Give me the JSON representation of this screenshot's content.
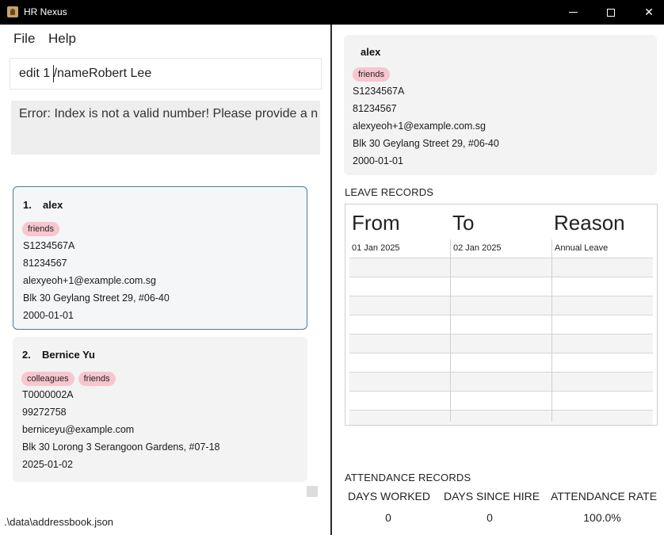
{
  "window": {
    "title": "HR Nexus",
    "minimize_label": "—",
    "close_label": "✕"
  },
  "menu": {
    "file": "File",
    "help": "Help"
  },
  "command": {
    "value": "edit 1 /nameRobert Lee"
  },
  "result": {
    "message": "Error: Index is not a valid number! Please provide a n"
  },
  "person_list": [
    {
      "index": "1.",
      "name": "alex",
      "tags": [
        "friends"
      ],
      "nric": "S1234567A",
      "phone": "81234567",
      "email": "alexyeoh+1@example.com.sg",
      "address": "Blk 30 Geylang Street 29, #06-40",
      "date": "2000-01-01"
    },
    {
      "index": "2.",
      "name": "Bernice Yu",
      "tags": [
        "colleagues",
        "friends"
      ],
      "nric": "T0000002A",
      "phone": "99272758",
      "email": "berniceyu@example.com",
      "address": "Blk 30 Lorong 3 Serangoon Gardens, #07-18",
      "date": "2025-01-02"
    }
  ],
  "status_bar": {
    "path": ".\\data\\addressbook.json"
  },
  "detail": {
    "name": "alex",
    "tags": [
      "friends"
    ],
    "nric": "S1234567A",
    "phone": "81234567",
    "email": "alexyeoh+1@example.com.sg",
    "address": "Blk 30 Geylang Street 29, #06-40",
    "date": "2000-01-01"
  },
  "leave": {
    "title": "LEAVE RECORDS",
    "columns": [
      "From",
      "To",
      "Reason"
    ],
    "rows": [
      [
        "01 Jan 2025",
        "02 Jan 2025",
        "Annual Leave"
      ]
    ]
  },
  "attendance": {
    "title": "ATTENDANCE RECORDS",
    "headers": [
      "DAYS WORKED",
      "DAYS SINCE HIRE",
      "ATTENDANCE RATE"
    ],
    "values": [
      "0",
      "0",
      "100.0%"
    ]
  },
  "colors": {
    "titlebar": "#000000",
    "tag": "#f7c6cf",
    "selected_border": "#4a7f96",
    "card": "#f3f3f3"
  }
}
